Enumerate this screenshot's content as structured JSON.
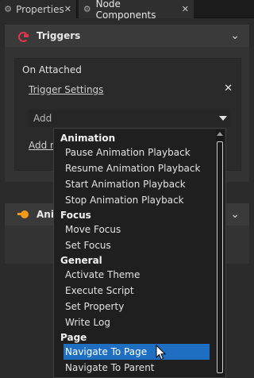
{
  "tabs": [
    {
      "label": "Properties",
      "icon": "gear-icon",
      "active": false
    },
    {
      "label": "Node Components",
      "icon": "gear-icon",
      "active": true
    }
  ],
  "triggers": {
    "title": "Triggers",
    "icon": "triggers-icon",
    "trigger_name": "On Attached",
    "settings_link": "Trigger Settings",
    "add_label": "Add",
    "add_node_link": "Add node"
  },
  "animations": {
    "title": "Animations",
    "icon": "animation-icon"
  },
  "dropdown": {
    "groups": [
      {
        "label": "Animation",
        "items": [
          "Pause Animation Playback",
          "Resume Animation Playback",
          "Start Animation Playback",
          "Stop Animation Playback"
        ]
      },
      {
        "label": "Focus",
        "items": [
          "Move Focus",
          "Set Focus"
        ]
      },
      {
        "label": "General",
        "items": [
          "Activate Theme",
          "Execute Script",
          "Set Property",
          "Write Log"
        ]
      },
      {
        "label": "Page",
        "items": [
          "Navigate To Page",
          "Navigate To Parent"
        ]
      }
    ],
    "selected": "Navigate To Page"
  },
  "colors": {
    "accent_selected": "#1e6fc1",
    "triggers_icon": "#e0344a",
    "animation_icon": "#f39a1e"
  }
}
